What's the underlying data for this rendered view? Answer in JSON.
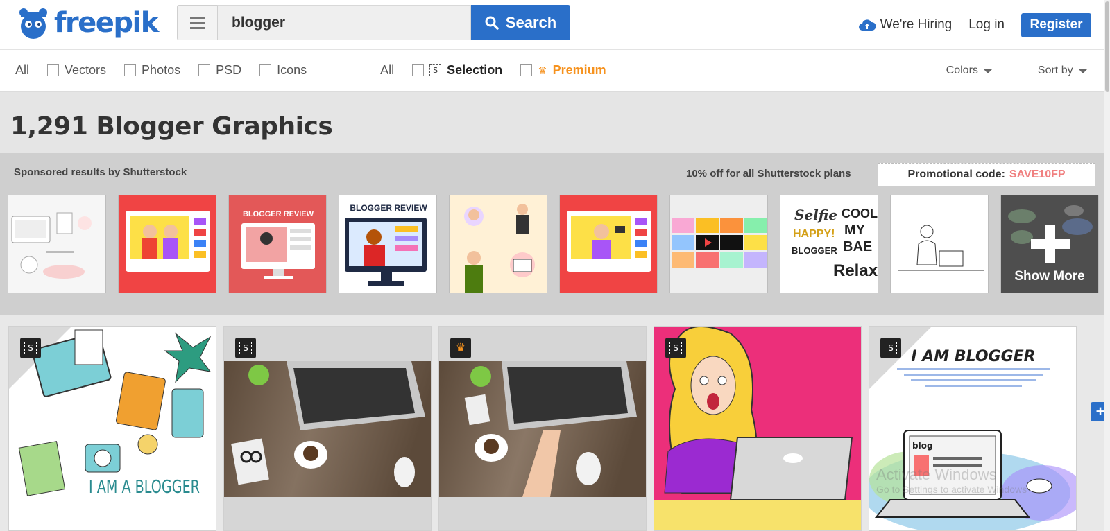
{
  "brand": {
    "logo_text": "freepik",
    "accent": "#2a6fc9"
  },
  "search": {
    "query": "blogger",
    "button_label": "Search"
  },
  "header": {
    "hiring": "We're Hiring",
    "login": "Log in",
    "register": "Register"
  },
  "filters": {
    "types": [
      "All",
      "Vectors",
      "Photos",
      "PSD",
      "Icons"
    ],
    "licenses": {
      "all": "All",
      "selection": "Selection",
      "premium": "Premium"
    },
    "colors": "Colors",
    "sort": "Sort by"
  },
  "results": {
    "title": "1,291 Blogger Graphics"
  },
  "sponsored": {
    "label": "Sponsored results by Shutterstock",
    "offer": "10% off for all Shutterstock plans",
    "promo_label": "Promotional code:",
    "promo_code": "SAVE10FP",
    "promo_color": "#f08080",
    "show_more": "Show More",
    "thumb_texts": {
      "t3": "BLOGGER REVIEW",
      "t4": "BLOGGER REVIEW",
      "t8a": "Selfie",
      "t8b": "COOL!",
      "t8c": "HAPPY!",
      "t8d": "MY",
      "t8e": "BAE",
      "t8f": "BLOGGER",
      "t8g": "Relax"
    }
  },
  "cards": {
    "c1_text": "I AM A BLOGGER",
    "c5_title": "I AM BLOGGER",
    "c5_small": "blog"
  },
  "watermark": {
    "line1": "Activate Windows",
    "line2": "Go to Settings to activate Windows"
  }
}
